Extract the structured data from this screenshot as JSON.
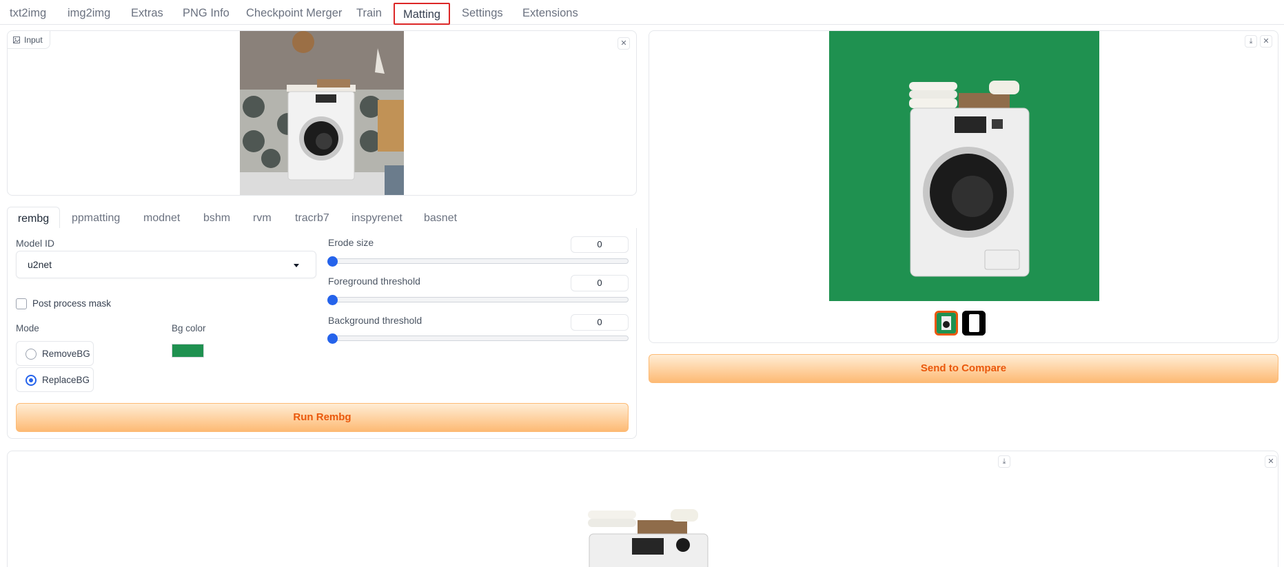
{
  "nav": {
    "tabs": [
      "txt2img",
      "img2img",
      "Extras",
      "PNG Info",
      "Checkpoint Merger",
      "Train",
      "Matting",
      "Settings",
      "Extensions"
    ],
    "active_tab": "Matting"
  },
  "input_panel": {
    "label": "Input",
    "label_icon": "image-icon",
    "clear_icon": "close-icon"
  },
  "method_tabs": [
    "rembg",
    "ppmatting",
    "modnet",
    "bshm",
    "rvm",
    "tracrb7",
    "inspyrenet",
    "basnet"
  ],
  "rembg": {
    "model_id_label": "Model ID",
    "model_id_value": "u2net",
    "post_process_label": "Post process mask",
    "post_process_checked": false,
    "mode_label": "Mode",
    "mode_options": [
      "RemoveBG",
      "ReplaceBG"
    ],
    "mode_selected": "ReplaceBG",
    "bg_color_label": "Bg color",
    "bg_color": "#1f9150",
    "erode_size_label": "Erode size",
    "erode_size_value": "0",
    "fg_threshold_label": "Foreground threshold",
    "fg_threshold_value": "0",
    "bg_threshold_label": "Background threshold",
    "bg_threshold_value": "0",
    "run_button": "Run Rembg"
  },
  "output_panel": {
    "download_icon": "download-icon",
    "close_icon": "close-icon",
    "thumbnails": [
      "result-thumbnail",
      "mask-thumbnail"
    ],
    "selected_thumbnail": 0
  },
  "send_button": "Send to Compare",
  "compare_panel": {
    "download_icon": "download-icon",
    "close_icon": "close-icon"
  },
  "colors": {
    "accent_orange": "#ea580c",
    "active_tab_border": "#dc2626",
    "radio_blue": "#2563eb",
    "green_bg": "#1f9150"
  }
}
